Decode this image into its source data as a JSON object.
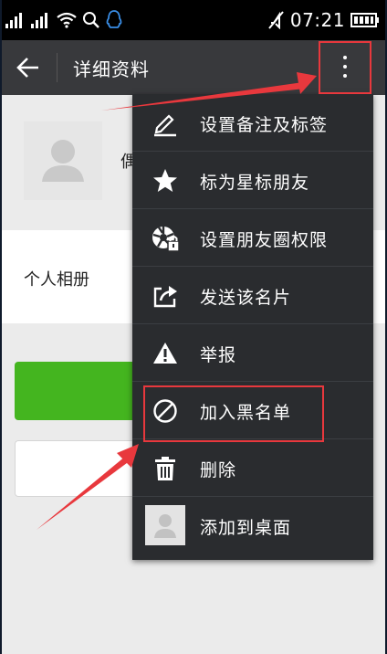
{
  "statusbar": {
    "time": "07:21",
    "icons": [
      "signal-1-icon",
      "signal-2-icon",
      "wifi-icon",
      "search-icon",
      "qq-icon",
      "mute-icon",
      "battery-icon"
    ]
  },
  "toolbar": {
    "back_icon": "back-arrow-icon",
    "title": "详细资料",
    "more_icon": "more-vertical-icon"
  },
  "profile": {
    "name_peek": "偶",
    "album_label": "个人相册"
  },
  "menu": {
    "items": [
      {
        "label": "设置备注及标签",
        "icon": "edit-pencil-icon"
      },
      {
        "label": "标为星标朋友",
        "icon": "star-icon"
      },
      {
        "label": "设置朋友圈权限",
        "icon": "moments-lock-icon"
      },
      {
        "label": "发送该名片",
        "icon": "share-icon"
      },
      {
        "label": "举报",
        "icon": "warning-icon"
      },
      {
        "label": "加入黑名单",
        "icon": "block-icon"
      },
      {
        "label": "删除",
        "icon": "trash-icon"
      },
      {
        "label": "添加到桌面",
        "icon": "avatar-icon"
      }
    ]
  },
  "annotations": {
    "highlight_color": "#e8383d",
    "highlighted": [
      "more-button",
      "加入黑名单"
    ]
  },
  "colors": {
    "toolbar": "#38393c",
    "menu": "#2a2c2f",
    "green_button": "#44b51f"
  }
}
